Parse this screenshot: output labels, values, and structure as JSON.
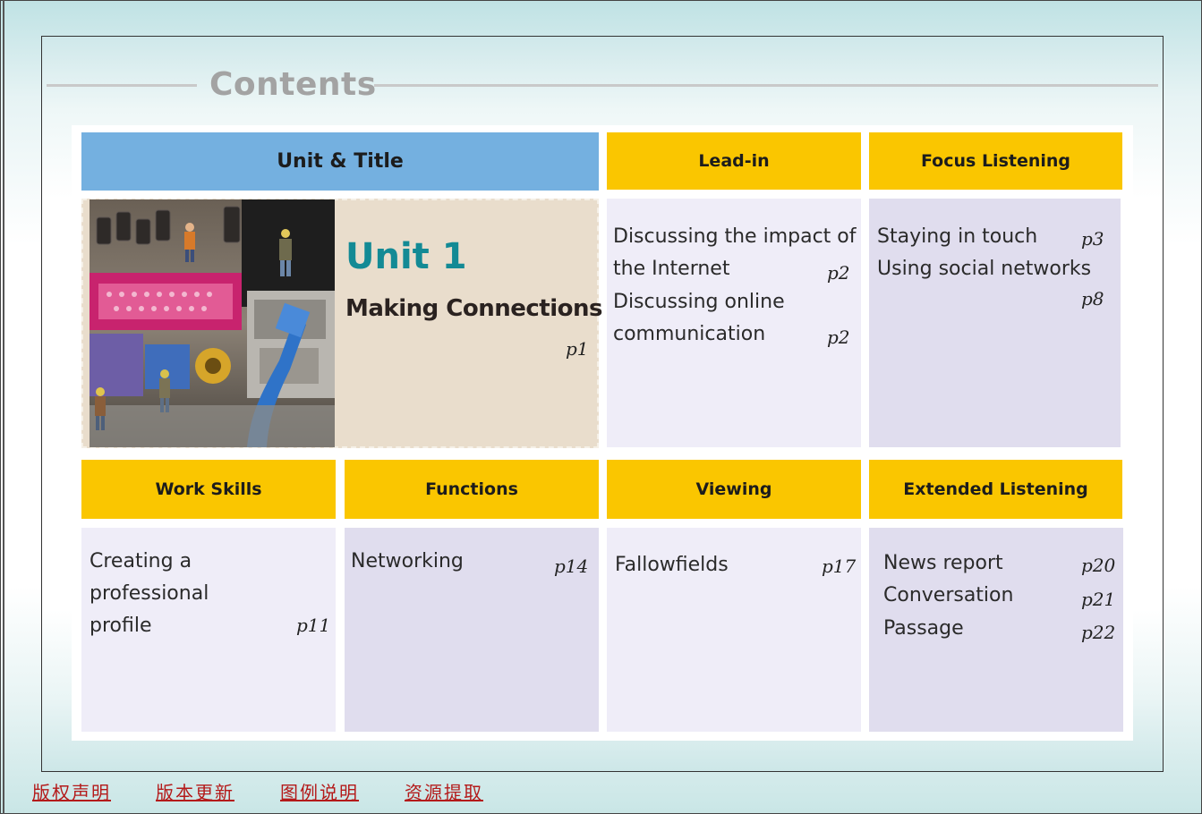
{
  "page_title": "Contents",
  "headers": {
    "unit_title": "Unit & Title",
    "lead_in": "Lead-in",
    "focus_listening": "Focus Listening",
    "work_skills": "Work Skills",
    "functions": "Functions",
    "viewing": "Viewing",
    "extended_listening": "Extended Listening"
  },
  "unit": {
    "number": "Unit 1",
    "title": "Making Connections",
    "page": "p1"
  },
  "lead_in": {
    "lines": [
      "Discussing the impact of",
      "the Internet",
      "Discussing online",
      "communication"
    ],
    "pages": [
      "p2",
      "p2"
    ]
  },
  "focus_listening": {
    "lines": [
      "Staying in touch",
      "Using social networks"
    ],
    "pages": [
      "p3",
      "p8"
    ]
  },
  "work_skills": {
    "lines": [
      "Creating a",
      "professional",
      "profile"
    ],
    "page": "p11"
  },
  "functions": {
    "line": "Networking",
    "page": "p14"
  },
  "viewing": {
    "line": "Fallowfields",
    "page": "p17"
  },
  "extended_listening": {
    "lines": [
      "News report",
      "Conversation",
      "Passage"
    ],
    "pages": [
      "p20",
      "p21",
      "p22"
    ]
  },
  "footer": {
    "links": [
      "版权声明",
      "版本更新",
      "图例说明",
      "资源提取"
    ]
  },
  "colors": {
    "header_gold": "#fac600",
    "header_blue": "#74b0e0",
    "unit_teal": "#138a95",
    "footer_red": "#b41a1a"
  }
}
